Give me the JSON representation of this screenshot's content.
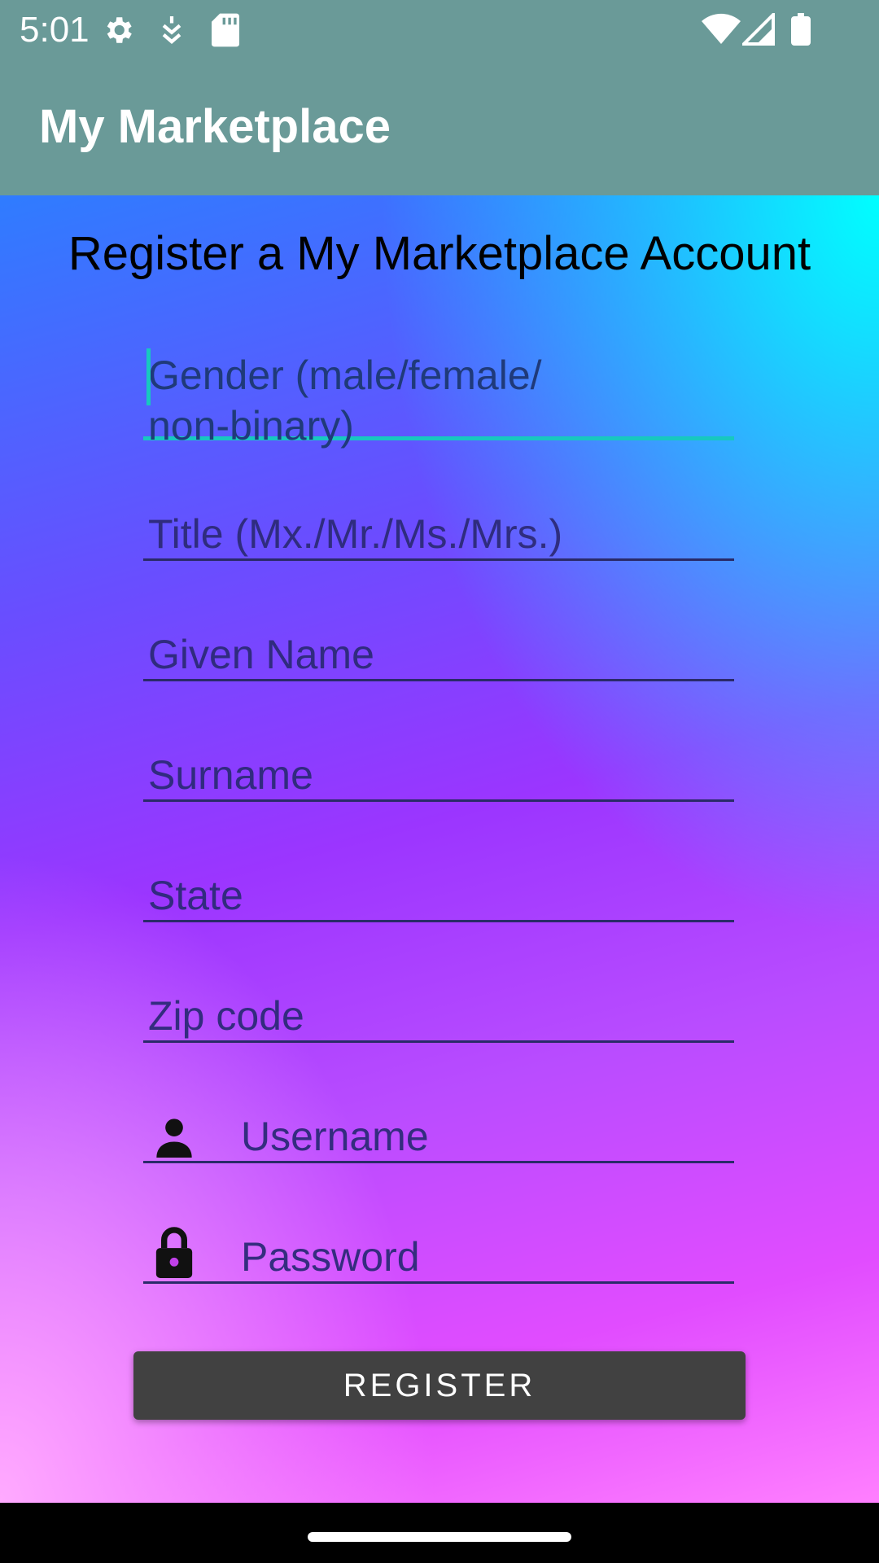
{
  "status_bar": {
    "time": "5:01",
    "icons": [
      "gear-icon",
      "notification-icon",
      "sd-card-icon",
      "wifi-icon",
      "signal-icon",
      "battery-icon"
    ]
  },
  "app_bar": {
    "title": "My Marketplace"
  },
  "form": {
    "heading": "Register a My Marketplace Account",
    "fields": {
      "gender": {
        "placeholder_line1": "Gender (male/female/",
        "placeholder_line2": "non-binary)"
      },
      "title": {
        "placeholder": "Title (Mx./Mr./Ms./Mrs.)"
      },
      "given_name": {
        "placeholder": "Given Name"
      },
      "surname": {
        "placeholder": "Surname"
      },
      "state": {
        "placeholder": "State"
      },
      "zip": {
        "placeholder": "Zip code"
      },
      "username": {
        "placeholder": "Username",
        "icon": "person-icon"
      },
      "password": {
        "placeholder": "Password",
        "icon": "lock-icon"
      }
    },
    "register_label": "REGISTER"
  },
  "colors": {
    "app_bar": "#6a9a98",
    "button": "#414141",
    "focus_accent": "#17c8c0"
  }
}
